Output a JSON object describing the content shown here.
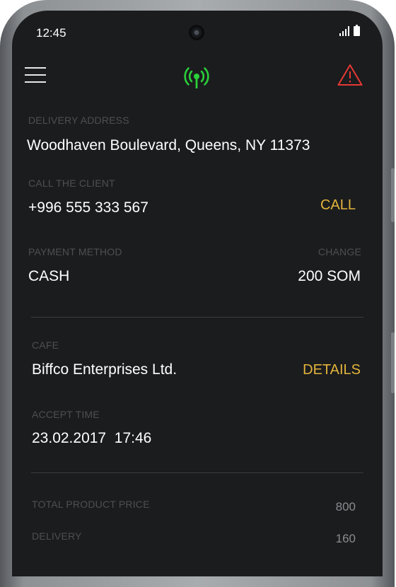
{
  "status_bar": {
    "time": "12:45"
  },
  "delivery_address": {
    "label": "DELIVERY ADDRESS",
    "value": "Woodhaven Boulevard, Queens, NY 11373"
  },
  "client": {
    "label": "CALL THE CLIENT",
    "phone": "+996 555 333 567",
    "call_label": "CALL"
  },
  "payment": {
    "label": "PAYMENT METHOD",
    "method": "CASH",
    "change_label": "CHANGE",
    "change_value": "200 SOM"
  },
  "cafe": {
    "label": "CAFE",
    "name": "Biffco Enterprises Ltd.",
    "details_label": "DETAILS"
  },
  "accept_time": {
    "label": "ACCEPT TIME",
    "value": "23.02.2017  17:46"
  },
  "totals": [
    {
      "label": "TOTAL PRODUCT PRICE",
      "value": "800"
    },
    {
      "label": "DELIVERY",
      "value": "160"
    }
  ],
  "colors": {
    "accent": "#e2b43b",
    "signal": "#2bd03a",
    "alert": "#e53935",
    "background": "#1b1c1e"
  },
  "icons": [
    "menu-icon",
    "antenna-icon",
    "alert-icon",
    "signal-icon",
    "battery-icon"
  ]
}
